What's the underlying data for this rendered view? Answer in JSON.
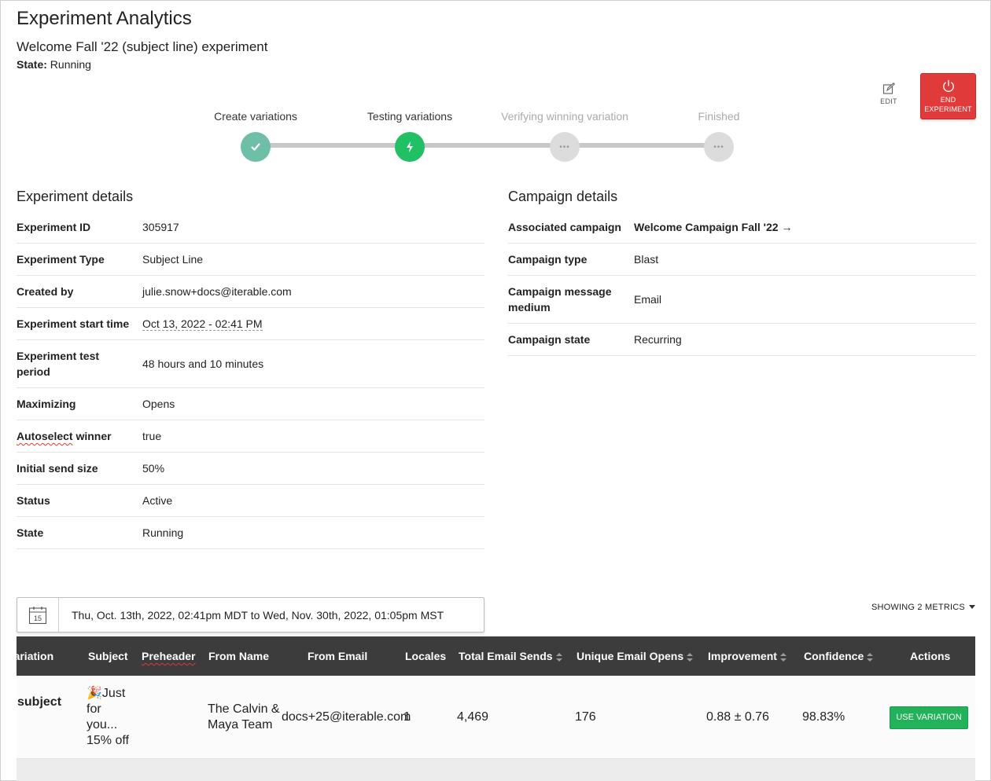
{
  "page": {
    "title": "Experiment Analytics",
    "experiment_name": "Welcome Fall '22 (subject line) experiment",
    "state_label": "State:",
    "state_value": "Running"
  },
  "actions": {
    "edit_label": "EDIT",
    "end_label_1": "END",
    "end_label_2": "EXPERIMENT"
  },
  "colors": {
    "end_button": "#e03a3a",
    "step_done": "#6fbfa8",
    "step_active": "#22c064",
    "use_variation": "#22b25a",
    "table_header": "#3c3c3c"
  },
  "stepper": {
    "steps": [
      {
        "label": "Create variations",
        "status": "done",
        "icon": "check-icon"
      },
      {
        "label": "Testing variations",
        "status": "active",
        "icon": "lightning-icon"
      },
      {
        "label": "Verifying winning variation",
        "status": "future",
        "icon": "ellipsis-icon"
      },
      {
        "label": "Finished",
        "status": "future",
        "icon": "ellipsis-icon"
      }
    ]
  },
  "experiment_details": {
    "title": "Experiment details",
    "rows": [
      {
        "key": "Experiment ID",
        "value": "305917"
      },
      {
        "key": "Experiment Type",
        "value": "Subject Line"
      },
      {
        "key": "Created by",
        "value": "julie.snow+docs@iterable.com"
      },
      {
        "key": "Experiment start time",
        "value": "Oct 13, 2022 - 02:41 PM"
      },
      {
        "key": "Experiment test period",
        "value": "48 hours and 10 minutes"
      },
      {
        "key": "Maximizing",
        "value": "Opens"
      },
      {
        "key_a": "Autoselect",
        "key_b": " winner",
        "value": "true"
      },
      {
        "key": "Initial send size",
        "value": "50%"
      },
      {
        "key": "Status",
        "value": "Active"
      },
      {
        "key": "State",
        "value": "Running"
      }
    ]
  },
  "campaign_details": {
    "title": "Campaign details",
    "rows": [
      {
        "key": "Associated campaign",
        "value": "Welcome Campaign Fall '22 →"
      },
      {
        "key": "Campaign type",
        "value": "Blast"
      },
      {
        "key": "Campaign message medium",
        "value": "Email"
      },
      {
        "key": "Campaign state",
        "value": "Recurring"
      }
    ]
  },
  "date_range": {
    "calendar_day": "15",
    "text": "Thu, Oct. 13th, 2022, 02:41pm MDT to Wed, Nov. 30th, 2022, 01:05pm MST"
  },
  "metrics_toggle": "SHOWING 2 METRICS",
  "table": {
    "columns": [
      "Variation",
      "Subject",
      "Preheader",
      "From Name",
      "From Email",
      "Locales",
      "Total Email Sends",
      "Unique Email Opens",
      "Improvement",
      "Confidence",
      "Actions"
    ],
    "rows": [
      {
        "variation": "subject",
        "subject_emoji": "🎉",
        "subject_lines": [
          "Just",
          "for",
          "you...",
          "15% off"
        ],
        "preheader": "",
        "from_name_lines": [
          "The Calvin &",
          "Maya Team"
        ],
        "from_email": "docs+25@iterable.com",
        "locales": "1",
        "total_sends": "4,469",
        "unique_opens": "176",
        "improvement": "0.88 ± 0.76",
        "confidence": "98.83%",
        "action_label": "USE VARIATION"
      }
    ]
  }
}
